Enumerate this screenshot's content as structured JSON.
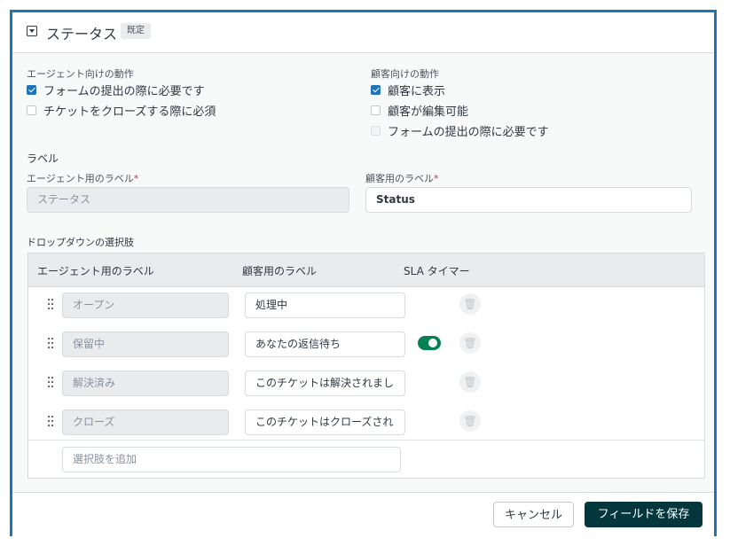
{
  "header": {
    "title": "ステータス",
    "badge": "既定"
  },
  "agent_actions": {
    "heading": "エージェント向けの動作",
    "items": [
      {
        "label": "フォームの提出の際に必要です",
        "checked": true,
        "disabled": false
      },
      {
        "label": "チケットをクローズする際に必須",
        "checked": false,
        "disabled": false
      }
    ]
  },
  "customer_actions": {
    "heading": "顧客向けの動作",
    "items": [
      {
        "label": "顧客に表示",
        "checked": true,
        "disabled": false
      },
      {
        "label": "顧客が編集可能",
        "checked": false,
        "disabled": false
      },
      {
        "label": "フォームの提出の際に必要です",
        "checked": false,
        "disabled": true
      }
    ]
  },
  "labels": {
    "heading": "ラベル",
    "agent_label": "エージェント用のラベル",
    "agent_value": "ステータス",
    "customer_label": "顧客用のラベル",
    "customer_value": "Status",
    "required_mark": "*"
  },
  "dropdown": {
    "heading": "ドロップダウンの選択肢",
    "columns": [
      "エージェント用のラベル",
      "顧客用のラベル",
      "SLA タイマー"
    ],
    "rows": [
      {
        "agent": "オープン",
        "customer": "処理中",
        "sla": false
      },
      {
        "agent": "保留中",
        "customer": "あなたの返信待ち",
        "sla": true
      },
      {
        "agent": "解決済み",
        "customer": "このチケットは解決されまし",
        "sla": false
      },
      {
        "agent": "クローズ",
        "customer": "このチケットはクローズされ",
        "sla": false
      }
    ],
    "add_placeholder": "選択肢を追加"
  },
  "footer": {
    "cancel": "キャンセル",
    "save": "フィールドを保存"
  },
  "colors": {
    "accent": "#1f73b7",
    "toggle_on": "#038153",
    "primary_button": "#03363d"
  }
}
